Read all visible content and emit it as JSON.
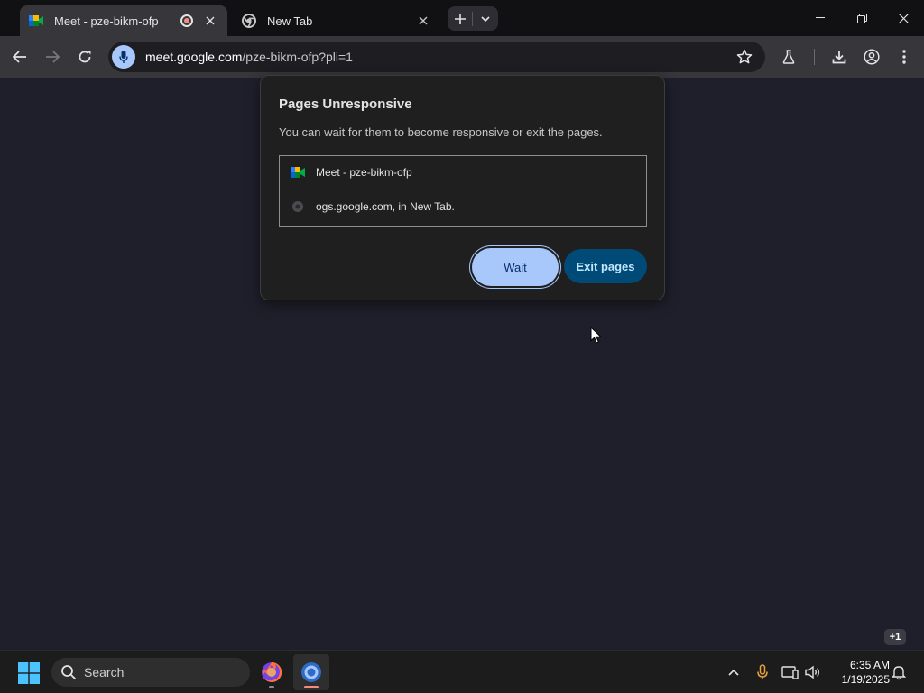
{
  "tabs": [
    {
      "title": "Meet - pze-bikm-ofp",
      "favicon": "google-meet-icon",
      "recording": true,
      "active": true
    },
    {
      "title": "New Tab",
      "favicon": "chrome-icon",
      "active": false
    }
  ],
  "omnibox": {
    "host": "meet.google.com",
    "path": "/pze-bikm-ofp?pli=1"
  },
  "dialog": {
    "title": "Pages Unresponsive",
    "description": "You can wait for them to become responsive or exit the pages.",
    "pages": [
      {
        "label": "Meet - pze-bikm-ofp",
        "icon": "google-meet-icon"
      },
      {
        "label": "ogs.google.com, in New Tab.",
        "icon": "globe-icon"
      }
    ],
    "wait_label": "Wait",
    "exit_label": "Exit pages"
  },
  "notification_badge": "+1",
  "taskbar": {
    "search_label": "Search",
    "clock_time": "6:35 AM",
    "clock_date": "1/19/2025"
  },
  "colors": {
    "accent": "#a8c7fa",
    "exit_button": "#004a77",
    "content_bg": "#1f1f2b"
  }
}
